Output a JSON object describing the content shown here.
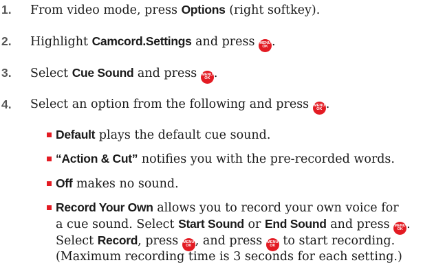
{
  "steps": [
    {
      "num": "1.",
      "pre": "From video mode, press ",
      "bold": "Options",
      "post": " (right softkey)."
    },
    {
      "num": "2.",
      "pre": "Highlight ",
      "bold": "Camcord.Settings",
      "post": " and press ",
      "end": "."
    },
    {
      "num": "3.",
      "pre": "Select ",
      "bold": "Cue Sound",
      "post": " and press ",
      "end": "."
    },
    {
      "num": "4.",
      "pre": "Select an option from the following and press ",
      "end": "."
    }
  ],
  "options": [
    {
      "bold": "Default",
      "text": " plays the default cue sound."
    },
    {
      "bold": "“Action & Cut”",
      "text": " notifies you with the pre-recorded words."
    },
    {
      "bold": "Off",
      "text": " makes no sound."
    },
    {
      "bold": "Record Your Own",
      "text": " allows you to record your own voice for"
    }
  ],
  "record_own": {
    "line2_pre": "a cue sound. Select ",
    "start_sound": "Start Sound",
    "or": " or ",
    "end_sound": "End Sound",
    "and_press": " and press ",
    "end": ".",
    "line3_pre": "Select ",
    "record": "Record",
    "press1": ", press ",
    "press2": ", and press ",
    "to_start": " to start recording.",
    "line4": "(Maximum recording time is 3 seconds for each setting.)"
  },
  "menu_key": {
    "top": "MENU",
    "bottom": "OK",
    "icon": "menu-ok-key-icon",
    "color": "#e31b23"
  },
  "colors": {
    "bullet": "#e31b23",
    "step_number": "#555555",
    "text": "#1a1a1a"
  }
}
